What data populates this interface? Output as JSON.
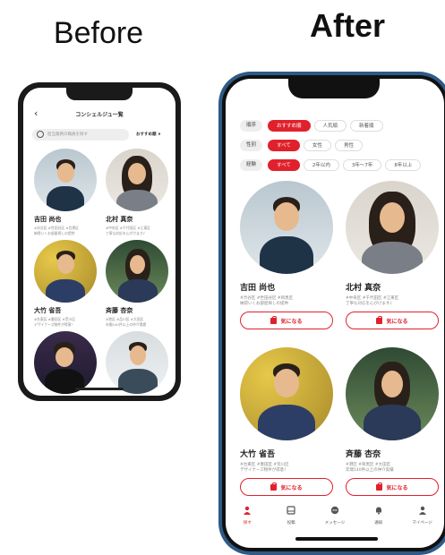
{
  "headings": {
    "before": "Before",
    "after": "After"
  },
  "before": {
    "nav_title": "コンシェルジュ一覧",
    "back_icon": "‹",
    "search_placeholder": "担当業務の職員を探す",
    "sort_label": "おすすめ順 ∨",
    "cards": [
      {
        "name": "吉田 尚也",
        "tags": "#渋谷区 #世田谷区 #目黒区",
        "intro": "納得いくお部屋探しの提供"
      },
      {
        "name": "北村 真奈",
        "tags": "#中央区 #千代田区 #江東区",
        "intro": "丁寧な対応を心がけます♪"
      },
      {
        "name": "大竹 省吾",
        "tags": "#台東区 #墨田区 #荒川区",
        "intro": "デザイナーズ物件が得意！"
      },
      {
        "name": "斉藤 杏奈",
        "tags": "#港区 #品川区 #大田区",
        "intro": "年間140件以上の仲介実績"
      }
    ]
  },
  "after": {
    "filters": {
      "order": {
        "label": "順序",
        "options": [
          "おすすめ順",
          "人気順",
          "新着順"
        ],
        "active": 0
      },
      "gender": {
        "label": "性別",
        "options": [
          "すべて",
          "女性",
          "男性"
        ],
        "active": 0
      },
      "experience": {
        "label": "経験",
        "options": [
          "すべて",
          "2年以内",
          "3年〜7年",
          "8年以上"
        ],
        "active": 0
      }
    },
    "cards": [
      {
        "name": "吉田 尚也",
        "tags": "#渋谷区 #世田谷区 #目黒区",
        "intro": "納得いくお部屋探しの提供",
        "button": "気になる"
      },
      {
        "name": "北村 真奈",
        "tags": "#中央区 #千代田区 #江東区",
        "intro": "丁寧な対応を心がけます♪",
        "button": "気になる"
      },
      {
        "name": "大竹 省吾",
        "tags": "#台東区 #墨田区 #荒川区",
        "intro": "デザイナーズ物件が得意！",
        "button": "気になる"
      },
      {
        "name": "斉藤 杏奈",
        "tags": "#港区 #目黒区 #大田区",
        "intro": "年間140件以上の仲介実績",
        "button": "気になる"
      }
    ],
    "tabs": [
      {
        "label": "探す",
        "icon": "person-search-icon",
        "active": true
      },
      {
        "label": "投稿",
        "icon": "post-icon",
        "active": false
      },
      {
        "label": "メッセージ",
        "icon": "message-icon",
        "active": false
      },
      {
        "label": "通知",
        "icon": "bell-icon",
        "active": false
      },
      {
        "label": "マイページ",
        "icon": "mypage-icon",
        "active": false
      }
    ]
  },
  "colors": {
    "accent": "#e0212c",
    "phone_after_frame": "#2e5a86",
    "phone_before_frame": "#1a1a1a"
  }
}
